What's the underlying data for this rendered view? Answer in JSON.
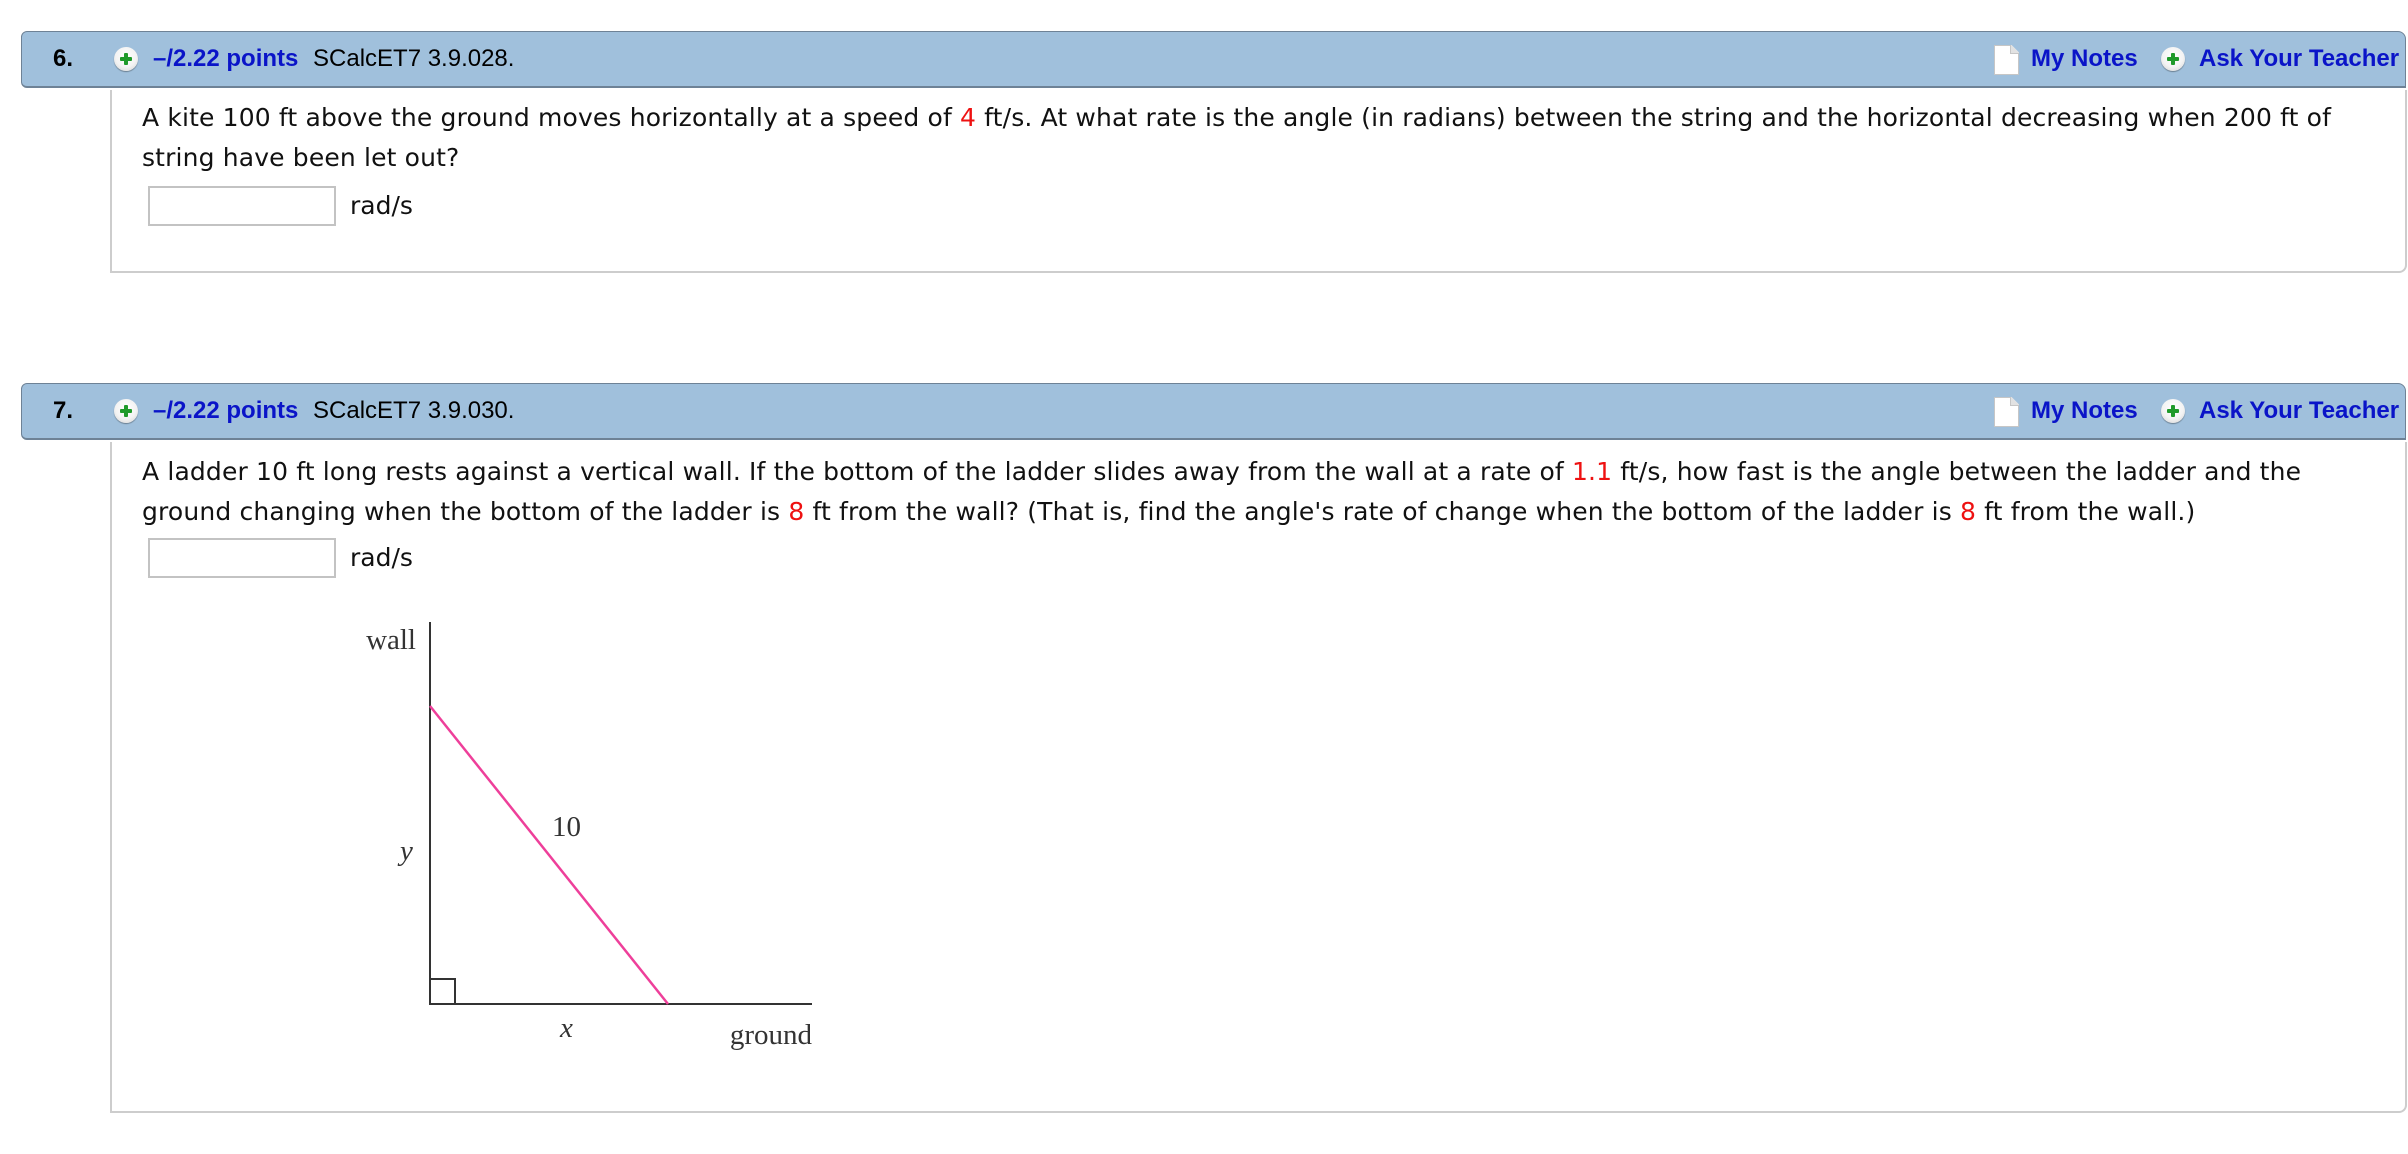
{
  "questions": [
    {
      "number": "6.",
      "points": "–/2.22 points",
      "reference": "SCalcET7 3.9.028.",
      "my_notes": "My Notes",
      "ask_teacher": "Ask Your Teacher",
      "text": {
        "segments": [
          "A kite 100 ft above the ground moves horizontally at a speed of ",
          "4",
          " ft/s. At what rate is the angle (in radians) between the string and the horizontal decreasing when 200 ft of string have been let out?"
        ]
      },
      "answer": {
        "value": "",
        "unit": "rad/s"
      }
    },
    {
      "number": "7.",
      "points": "–/2.22 points",
      "reference": "SCalcET7 3.9.030.",
      "my_notes": "My Notes",
      "ask_teacher": "Ask Your Teacher",
      "text": {
        "segments": [
          "A ladder 10 ft long rests against a vertical wall. If the bottom of the ladder slides away from the wall at a rate of ",
          "1.1",
          " ft/s, how fast is the angle between the ladder and the ground changing when the bottom of the ladder is ",
          "8",
          " ft from the wall? (That is, find the angle's rate of change when the bottom of the ladder is ",
          "8",
          " ft from the wall.)"
        ]
      },
      "answer": {
        "value": "",
        "unit": "rad/s"
      },
      "diagram": {
        "wall_label": "wall",
        "ground_label": "ground",
        "ladder_label": "10",
        "vertical_label": "y",
        "horizontal_label": "x",
        "ladder_color": "#ee3f9a"
      }
    }
  ],
  "colors": {
    "header_bg": "#a0c0dc",
    "link": "#0a14c8",
    "highlight": "#ee1111"
  }
}
